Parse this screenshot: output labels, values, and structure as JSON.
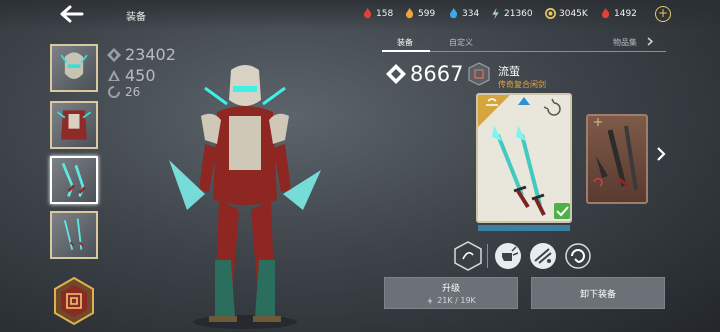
{
  "header": {
    "title": "装备"
  },
  "resources": [
    {
      "icon": "red-flame-icon",
      "value": "158",
      "color": "#e0413a"
    },
    {
      "icon": "orange-flame-icon",
      "value": "599",
      "color": "#f2a23a"
    },
    {
      "icon": "blue-flame-icon",
      "value": "334",
      "color": "#3fa9e8"
    },
    {
      "icon": "energy-icon",
      "value": "21360",
      "color": "#a9c7e0"
    },
    {
      "icon": "gold-coin-icon",
      "value": "3045K",
      "color": "#e8c766"
    },
    {
      "icon": "ruby-icon",
      "value": "1492",
      "color": "#e0413a"
    }
  ],
  "character_stats": {
    "power": "23402",
    "level": "450",
    "rank": "26"
  },
  "tabs": {
    "equipment": "装备",
    "custom": "自定义",
    "collection": "物品集"
  },
  "item": {
    "power": "8667",
    "name": "流萤",
    "subtitle": "传奇复合闲剑"
  },
  "actions": {
    "upgrade_label": "升级",
    "upgrade_cost": "21K / 19K",
    "unequip_label": "卸下装备"
  }
}
